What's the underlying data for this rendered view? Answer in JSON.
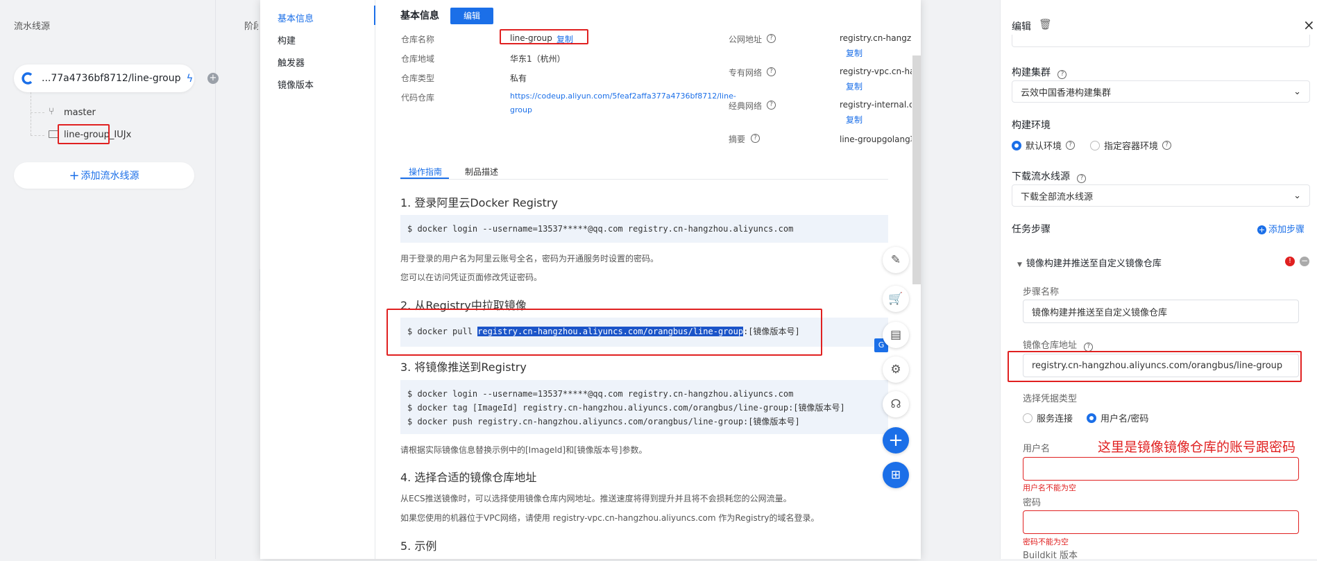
{
  "left": {
    "section_title": "流水线源",
    "stage_title": "阶段",
    "source_name": "...77a4736bf8712/line-group",
    "branch": "master",
    "folder": "line-group_IUJx",
    "add_source": "添加流水线源"
  },
  "modal": {
    "nav": [
      "基本信息",
      "构建",
      "触发器",
      "镜像版本"
    ],
    "header_title": "基本信息",
    "edit_button": "编辑",
    "info": {
      "repo_name_label": "仓库名称",
      "repo_name": "line-group",
      "copy": "复制",
      "region_label": "仓库地域",
      "region": "华东1（杭州）",
      "type_label": "仓库类型",
      "type": "私有",
      "code_label": "代码仓库",
      "code_url_line1": "https://codeup.aliyun.com/5feaf2affa377a4736bf8712/line-",
      "code_url_line2": "group",
      "public_label": "公网地址",
      "public_value": "registry.cn-hangzh",
      "vpc_label": "专有网络",
      "vpc_value": "registry-vpc.cn-har",
      "classic_label": "经典网络",
      "classic_value": "registry-internal.cn",
      "summary_label": "摘要",
      "summary_value": "line-groupgolang项"
    },
    "tabs": [
      "操作指南",
      "制品描述"
    ],
    "step1_title": "1. 登录阿里云Docker Registry",
    "step1_code": "$ docker login --username=13537*****@qq.com registry.cn-hangzhou.aliyuncs.com",
    "step1_note1": "用于登录的用户名为阿里云账号全名，密码为开通服务时设置的密码。",
    "step1_note2": "您可以在访问凭证页面修改凭证密码。",
    "step2_title": "2. 从Registry中拉取镜像",
    "step2_prefix": "$ docker pull ",
    "step2_selected": "registry.cn-hangzhou.aliyuncs.com/orangbus/line-group",
    "step2_suffix": ":[镜像版本号]",
    "step3_title": "3. 将镜像推送到Registry",
    "step3_code": "$ docker login --username=13537*****@qq.com registry.cn-hangzhou.aliyuncs.com\n$ docker tag [ImageId] registry.cn-hangzhou.aliyuncs.com/orangbus/line-group:[镜像版本号]\n$ docker push registry.cn-hangzhou.aliyuncs.com/orangbus/line-group:[镜像版本号]",
    "step3_note": "请根据实际镜像信息替换示例中的[ImageId]和[镜像版本号]参数。",
    "step4_title": "4. 选择合适的镜像仓库地址",
    "step4_note1": "从ECS推送镜像时，可以选择使用镜像仓库内网地址。推送速度将得到提升并且将不会损耗您的公网流量。",
    "step4_note2": "如果您使用的机器位于VPC网络，请使用 registry-vpc.cn-hangzhou.aliyuncs.com 作为Registry的域名登录。",
    "step5_title": "5. 示例"
  },
  "right": {
    "title": "编辑",
    "cluster_label": "构建集群",
    "cluster_value": "云效中国香港构建集群",
    "env_label": "构建环境",
    "env_default": "默认环境",
    "env_container": "指定容器环境",
    "download_label": "下载流水线源",
    "download_value": "下载全部流水线源",
    "steps_label": "任务步骤",
    "add_step": "添加步骤",
    "step_title": "镜像构建并推送至自定义镜像仓库",
    "step_name_label": "步骤名称",
    "step_name_value": "镜像构建并推送至自定义镜像仓库",
    "repo_addr_label": "镜像仓库地址",
    "repo_addr_value": "registry.cn-hangzhou.aliyuncs.com/orangbus/line-group",
    "cred_type_label": "选择凭据类型",
    "cred_service": "服务连接",
    "cred_userpass": "用户名/密码",
    "annotation": "这里是镜像镜像仓库的账号跟密码",
    "username_label": "用户名",
    "username_error": "用户名不能为空",
    "password_label": "密码",
    "password_error": "密码不能为空",
    "buildkit_label": "Buildkit 版本"
  }
}
